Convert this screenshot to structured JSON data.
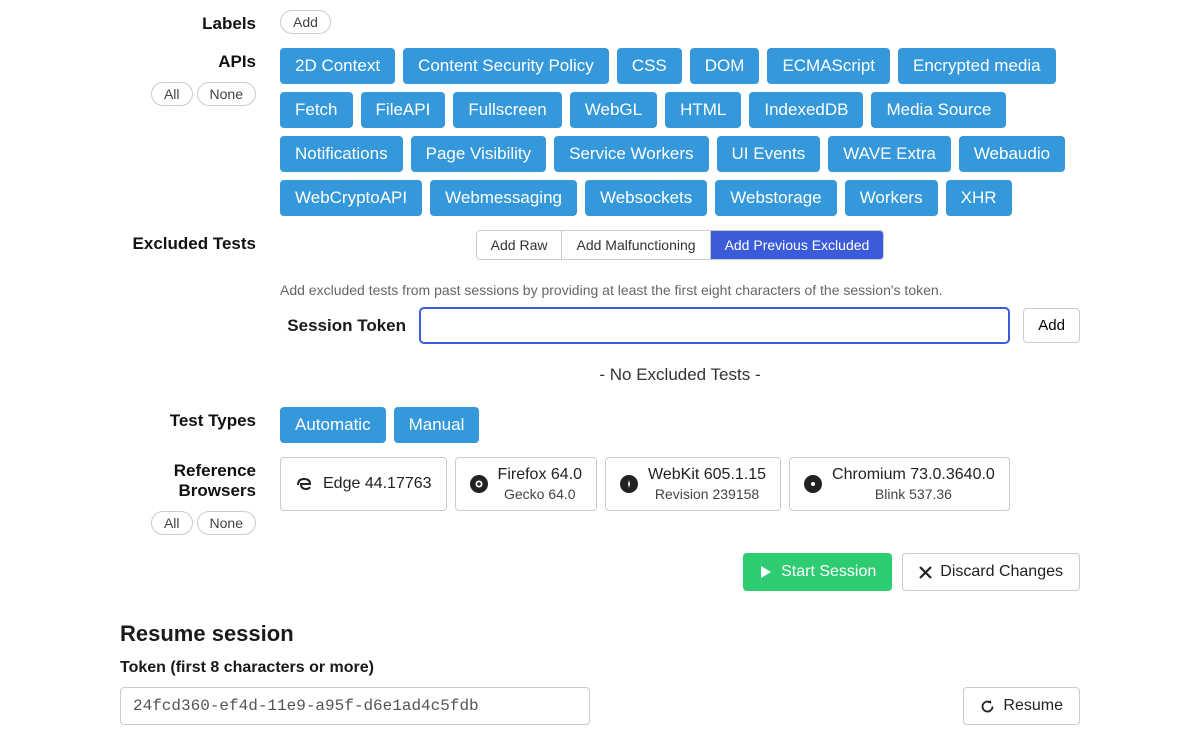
{
  "labels": {
    "title": "Labels",
    "add": "Add"
  },
  "apis": {
    "title": "APIs",
    "all": "All",
    "none": "None",
    "items": [
      "2D Context",
      "Content Security Policy",
      "CSS",
      "DOM",
      "ECMAScript",
      "Encrypted media",
      "Fetch",
      "FileAPI",
      "Fullscreen",
      "WebGL",
      "HTML",
      "IndexedDB",
      "Media Source",
      "Notifications",
      "Page Visibility",
      "Service Workers",
      "UI Events",
      "WAVE Extra",
      "Webaudio",
      "WebCryptoAPI",
      "Webmessaging",
      "Websockets",
      "Webstorage",
      "Workers",
      "XHR"
    ]
  },
  "excluded": {
    "title": "Excluded Tests",
    "tabs": {
      "raw": "Add Raw",
      "mal": "Add Malfunctioning",
      "prev": "Add Previous Excluded"
    },
    "hint": "Add excluded tests from past sessions by providing at least the first eight characters of the session's token.",
    "session_token_label": "Session Token",
    "add": "Add",
    "none_text": "- No Excluded Tests -"
  },
  "testtypes": {
    "title": "Test Types",
    "items": [
      "Automatic",
      "Manual"
    ]
  },
  "refbrowsers": {
    "title": "Reference Browsers",
    "all": "All",
    "none": "None",
    "items": [
      {
        "icon": "e",
        "main": "Edge 44.17763",
        "sub": ""
      },
      {
        "icon": "firefox",
        "main": "Firefox 64.0",
        "sub": "Gecko 64.0"
      },
      {
        "icon": "webkit",
        "main": "WebKit 605.1.15",
        "sub": "Revision 239158"
      },
      {
        "icon": "chrome",
        "main": "Chromium 73.0.3640.0",
        "sub": "Blink 537.36"
      }
    ]
  },
  "actions": {
    "start": "Start Session",
    "discard": "Discard Changes"
  },
  "resume": {
    "heading": "Resume session",
    "label": "Token (first 8 characters or more)",
    "value": "24fcd360-ef4d-11e9-a95f-d6e1ad4c5fdb",
    "button": "Resume"
  }
}
